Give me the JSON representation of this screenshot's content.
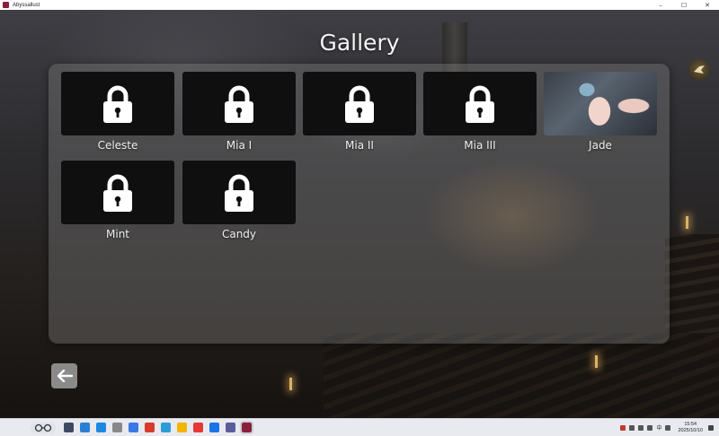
{
  "window": {
    "title": "Abyssallust",
    "controls": [
      "–",
      "☐",
      "✕"
    ]
  },
  "gallery": {
    "title": "Gallery",
    "items": [
      {
        "label": "Celeste",
        "locked": true
      },
      {
        "label": "Mia I",
        "locked": true
      },
      {
        "label": "Mia II",
        "locked": true
      },
      {
        "label": "Mia III",
        "locked": true
      },
      {
        "label": "Jade",
        "locked": false
      },
      {
        "label": "Mint",
        "locked": true
      },
      {
        "label": "Candy",
        "locked": true
      }
    ]
  },
  "icons": {
    "lock": "lock-icon",
    "back": "arrow-left-icon",
    "side": "bird-emblem-icon"
  },
  "taskbar": {
    "time": "15:54",
    "date": "2025/10/10",
    "ime": "中",
    "apps": [
      "#3d4a62",
      "#2a7fd4",
      "#1e88e5",
      "#888888",
      "#3b78e7",
      "#d83b2c",
      "#2b9cd8",
      "#f4b400",
      "#e53935",
      "#1a73e8",
      "#5c5c9c",
      "#8a1f3a"
    ]
  },
  "colors": {
    "panel": "#7a7a7a",
    "thumb": "#0f0f0f",
    "label": "#f0f0f0"
  }
}
